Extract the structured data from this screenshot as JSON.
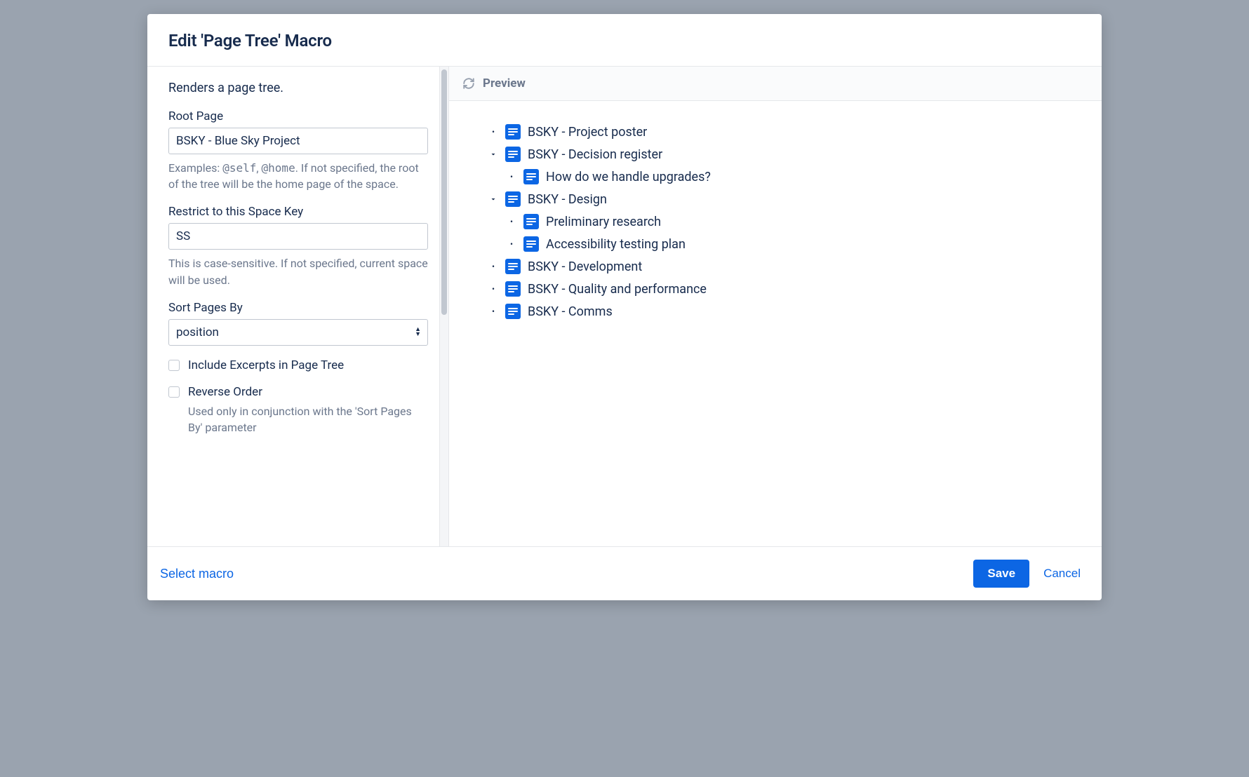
{
  "header": {
    "title": "Edit 'Page Tree' Macro"
  },
  "config": {
    "description": "Renders a page tree.",
    "root_page": {
      "label": "Root Page",
      "value": "BSKY - Blue Sky Project",
      "help_prefix": "Examples: ",
      "help_code1": "@self",
      "help_sep": ", ",
      "help_code2": "@home",
      "help_suffix": ". If not specified, the root of the tree will be the home page of the space."
    },
    "space_key": {
      "label": "Restrict to this Space Key",
      "value": "SS",
      "help": "This is case-sensitive. If not specified, current space will be used."
    },
    "sort": {
      "label": "Sort Pages By",
      "value": "position"
    },
    "include_excerpts": {
      "label": "Include Excerpts in Page Tree",
      "checked": false
    },
    "reverse_order": {
      "label": "Reverse Order",
      "checked": false,
      "help": "Used only in conjunction with the 'Sort Pages By' parameter"
    }
  },
  "preview": {
    "title": "Preview",
    "items": [
      {
        "label": "BSKY - Project poster",
        "expandable": false
      },
      {
        "label": "BSKY - Decision register",
        "expandable": true,
        "children": [
          {
            "label": "How do we handle upgrades?"
          }
        ]
      },
      {
        "label": "BSKY - Design",
        "expandable": true,
        "children": [
          {
            "label": "Preliminary research"
          },
          {
            "label": "Accessibility testing plan"
          }
        ]
      },
      {
        "label": "BSKY - Development",
        "expandable": false
      },
      {
        "label": "BSKY - Quality and performance",
        "expandable": false
      },
      {
        "label": "BSKY - Comms",
        "expandable": false
      }
    ]
  },
  "footer": {
    "select_macro": "Select macro",
    "save": "Save",
    "cancel": "Cancel"
  }
}
